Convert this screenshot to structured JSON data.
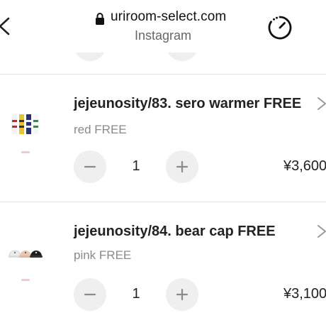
{
  "header": {
    "url": "uriroom-select.com",
    "subtitle": "Instagram"
  },
  "icons": {
    "back": "chevron-left-icon",
    "lock": "lock-icon",
    "timer": "timer-icon",
    "decrement": "minus-icon",
    "increment": "plus-icon",
    "item_chevron": "chevron-right-icon"
  },
  "colors": {
    "background": "#ffffff",
    "stepper_bg": "#efefef",
    "divider": "#e3e3e3",
    "variant_text": "#8a8a8a"
  },
  "cart": {
    "items": [
      {
        "name": "jejeunosity/83. sero warmer FREE",
        "variant": "red FREE",
        "quantity": "1",
        "price": "¥3,600"
      },
      {
        "name": "jejeunosity/84. bear cap FREE",
        "variant": "pink FREE",
        "quantity": "1",
        "price": "¥3,100"
      }
    ]
  }
}
